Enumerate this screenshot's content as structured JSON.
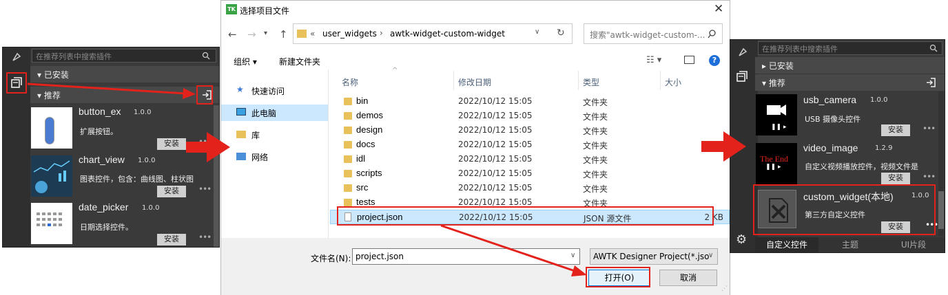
{
  "left_panel": {
    "search_placeholder": "在推荐列表中搜索插件",
    "installed_section": "已安装",
    "recommended_section": "推荐",
    "items": [
      {
        "name": "button_ex",
        "version": "1.0.0",
        "desc": "扩展按钮。",
        "install": "安装"
      },
      {
        "name": "chart_view",
        "version": "1.0.0",
        "desc": "图表控件，包含：曲线图、柱状图",
        "install": "安装"
      },
      {
        "name": "date_picker",
        "version": "1.0.0",
        "desc": "日期选择控件。",
        "install": "安装"
      }
    ]
  },
  "dialog": {
    "title": "选择项目文件",
    "title_icon": "TK",
    "breadcrumb": {
      "prefix": "«",
      "parts": [
        "user_widgets",
        "awtk-widget-custom-widget"
      ]
    },
    "search_placeholder": "搜索\"awtk-widget-custom-...",
    "toolbar": {
      "organize": "组织 ▾",
      "new_folder": "新建文件夹"
    },
    "nav": [
      "快速访问",
      "此电脑",
      "库",
      "网络"
    ],
    "columns": {
      "name": "名称",
      "date": "修改日期",
      "type": "类型",
      "size": "大小"
    },
    "files": [
      {
        "name": "bin",
        "date": "2022/10/12 15:05",
        "type": "文件夹",
        "size": ""
      },
      {
        "name": "demos",
        "date": "2022/10/12 15:05",
        "type": "文件夹",
        "size": ""
      },
      {
        "name": "design",
        "date": "2022/10/12 15:05",
        "type": "文件夹",
        "size": ""
      },
      {
        "name": "docs",
        "date": "2022/10/12 15:05",
        "type": "文件夹",
        "size": ""
      },
      {
        "name": "idl",
        "date": "2022/10/12 15:05",
        "type": "文件夹",
        "size": ""
      },
      {
        "name": "scripts",
        "date": "2022/10/12 15:05",
        "type": "文件夹",
        "size": ""
      },
      {
        "name": "src",
        "date": "2022/10/12 15:05",
        "type": "文件夹",
        "size": ""
      },
      {
        "name": "tests",
        "date": "2022/10/12 15:05",
        "type": "文件夹",
        "size": ""
      },
      {
        "name": "project.json",
        "date": "2022/10/12 15:05",
        "type": "JSON 源文件",
        "size": "2 KB"
      }
    ],
    "filename_label": "文件名(N):",
    "filename_value": "project.json",
    "filter": "AWTK Designer Project(*.jso",
    "open_button": "打开(O)",
    "cancel_button": "取消"
  },
  "right_panel": {
    "search_placeholder": "在推荐列表中搜索插件",
    "installed_section": "已安装",
    "recommended_section": "推荐",
    "items": [
      {
        "name": "usb_camera",
        "version": "1.0.0",
        "desc": "USB 摄像头控件",
        "install": "安装"
      },
      {
        "name": "video_image",
        "version": "1.2.9",
        "desc": "自定义视频播放控件，视频文件是",
        "install": "安装",
        "thumb_text": "The End"
      },
      {
        "name": "custom_widget(本地)",
        "version": "1.0.0",
        "desc": "第三方自定义控件",
        "install": "安装"
      }
    ],
    "tabs": [
      "自定义控件",
      "主题",
      "UI片段"
    ]
  }
}
